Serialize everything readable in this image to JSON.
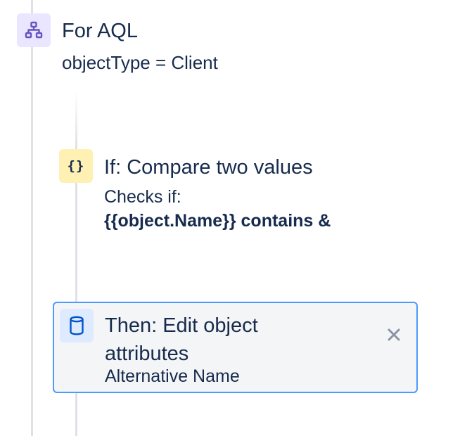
{
  "branch": {
    "icon": "hierarchy-icon",
    "title": "For AQL",
    "subtitle": "objectType = Client"
  },
  "condition": {
    "icon": "braces-icon",
    "icon_text": "{}",
    "title": "If: Compare two values",
    "line1": "Checks if:",
    "line2": "{{object.Name}} contains &"
  },
  "action": {
    "icon": "database-icon",
    "title": "Then: Edit object attributes",
    "subtitle": "Alternative Name",
    "close_icon": "close-icon"
  },
  "colors": {
    "text": "#172b4d",
    "rail": "#dfe1e6",
    "branch_icon_bg": "#eae6ff",
    "branch_icon_fg": "#6554c0",
    "condition_icon_bg": "#fff0b3",
    "action_icon_bg": "#deebff",
    "action_icon_fg": "#0052cc",
    "selected_border": "#4c9aff",
    "card_bg": "#f4f5f7",
    "close_icon": "#8993a4"
  }
}
